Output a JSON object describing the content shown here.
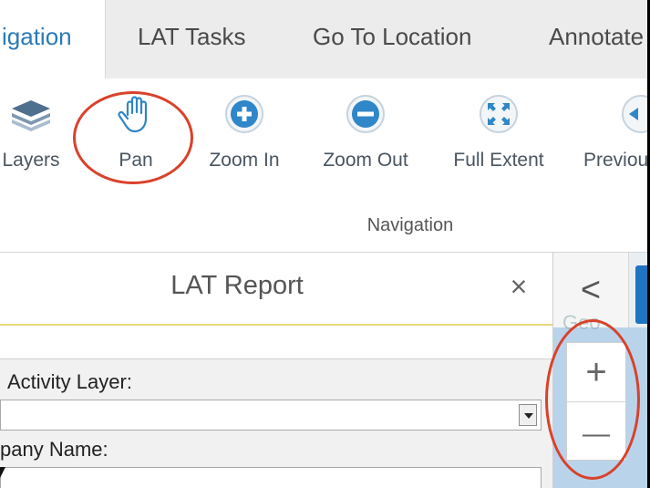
{
  "tabs": [
    {
      "label": "igation",
      "active": true
    },
    {
      "label": "LAT Tasks",
      "active": false
    },
    {
      "label": "Go To Location",
      "active": false
    },
    {
      "label": "Annotate",
      "active": false
    }
  ],
  "ribbon": {
    "tools": [
      {
        "label": "Layers",
        "icon": "layers-icon"
      },
      {
        "label": "Pan",
        "icon": "hand-icon"
      },
      {
        "label": "Zoom In",
        "icon": "plus-circle-icon"
      },
      {
        "label": "Zoom Out",
        "icon": "minus-circle-icon"
      },
      {
        "label": "Full Extent",
        "icon": "full-extent-icon"
      },
      {
        "label": "Previou",
        "icon": "previous-icon"
      }
    ],
    "group_label": "Navigation"
  },
  "panel": {
    "title": "LAT Report",
    "close_glyph": "×",
    "activity_layer_label": "Activity Layer:",
    "activity_layer_value": "",
    "company_name_label": "pany Name:",
    "company_name_value": ""
  },
  "map": {
    "collapse_glyph": "<",
    "ghost_text": "Geo",
    "zoom_in_glyph": "+",
    "zoom_out_glyph": "—"
  },
  "colors": {
    "active_tab_text": "#2a7ab8",
    "icon_blue": "#2f86c8",
    "callout_red": "#d9412b",
    "panel_accent": "#e8d87a",
    "map_blue": "#1f73c2"
  }
}
